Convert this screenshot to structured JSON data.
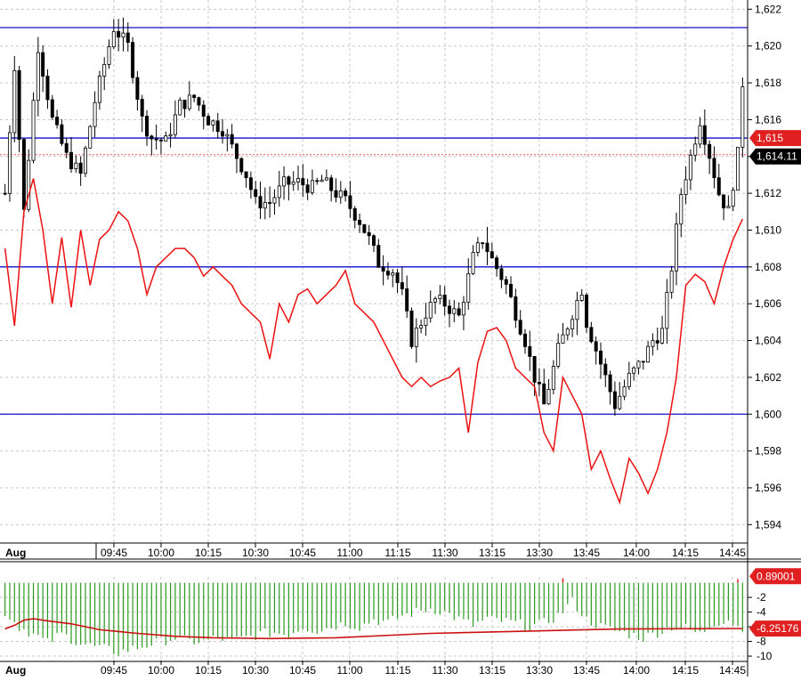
{
  "chart_data": [
    {
      "type": "candlestick",
      "panel": "price",
      "ylim": [
        1593,
        1622.5
      ],
      "yticks": [
        1594,
        1596,
        1598,
        1600,
        1602,
        1604,
        1606,
        1608,
        1610,
        1612,
        1614,
        1616,
        1618,
        1620,
        1622
      ],
      "ytick_labels": [
        "1,594",
        "1,596",
        "1,598",
        "1,600",
        "1,602",
        "1,604",
        "1,606",
        "1,608",
        "1,610",
        "1,612",
        "1,614",
        "1,616",
        "1,618",
        "1,620",
        "1,622"
      ],
      "date_label": "Aug",
      "xtick_labels": [
        "09:45",
        "10:00",
        "10:15",
        "10:30",
        "10:45",
        "11:00",
        "11:15",
        "11:30",
        "13:15",
        "13:30",
        "13:45",
        "14:00",
        "14:15",
        "14:45"
      ],
      "horizontal_levels": [
        1621,
        1615,
        1608,
        1600
      ],
      "last_price": 1614.1,
      "price_tags": [
        {
          "value": 1615,
          "label": "1,615",
          "color": "#e02020"
        },
        {
          "value": 1614.1,
          "label": "1,614.11",
          "color": "#000000"
        }
      ],
      "close_path": [
        [
          0,
          1612
        ],
        [
          2,
          1619
        ],
        [
          4,
          1611
        ],
        [
          7,
          1620
        ],
        [
          10,
          1616
        ],
        [
          13,
          1614
        ],
        [
          16,
          1613
        ],
        [
          19,
          1617
        ],
        [
          21,
          1619
        ],
        [
          23,
          1621
        ],
        [
          26,
          1620
        ],
        [
          29,
          1616
        ],
        [
          31,
          1615
        ],
        [
          34,
          1614.8
        ],
        [
          37,
          1616.8
        ],
        [
          40,
          1617.2
        ],
        [
          43,
          1616
        ],
        [
          46,
          1615.5
        ],
        [
          49,
          1614
        ],
        [
          51,
          1613
        ],
        [
          53,
          1611.5
        ],
        [
          56,
          1611.5
        ],
        [
          59,
          1612.5
        ],
        [
          62,
          1612.6
        ],
        [
          65,
          1612.3
        ],
        [
          67,
          1612.7
        ],
        [
          70,
          1612
        ],
        [
          72,
          1611.6
        ],
        [
          75,
          1610.5
        ],
        [
          77,
          1609.5
        ],
        [
          79,
          1608.2
        ],
        [
          82,
          1607.8
        ],
        [
          84,
          1606.5
        ],
        [
          86,
          1604
        ],
        [
          89,
          1605.5
        ],
        [
          91,
          1606.2
        ],
        [
          93,
          1606
        ],
        [
          96,
          1605.3
        ],
        [
          99,
          1608.5
        ],
        [
          101,
          1609.5
        ],
        [
          103,
          1608.4
        ],
        [
          106,
          1607
        ],
        [
          108,
          1605.5
        ],
        [
          110,
          1604
        ],
        [
          112,
          1602
        ],
        [
          114,
          1600.5
        ],
        [
          117,
          1603.5
        ],
        [
          120,
          1605.5
        ],
        [
          122,
          1606.8
        ],
        [
          123,
          1605
        ],
        [
          125,
          1603.5
        ],
        [
          127,
          1602
        ],
        [
          129,
          1600.5
        ],
        [
          132,
          1602
        ],
        [
          135,
          1603
        ],
        [
          137,
          1604
        ],
        [
          139,
          1604.5
        ],
        [
          141,
          1608
        ],
        [
          143,
          1612
        ],
        [
          145,
          1614
        ],
        [
          147,
          1616
        ],
        [
          149,
          1614.1
        ],
        [
          151,
          1612
        ],
        [
          153,
          1611
        ],
        [
          155,
          1614.1
        ],
        [
          156,
          1618
        ]
      ],
      "indicator_line": {
        "color": "#ee1111",
        "points": [
          [
            0,
            1609
          ],
          [
            2,
            1604.8
          ],
          [
            4,
            1611
          ],
          [
            6,
            1612.8
          ],
          [
            8,
            1610
          ],
          [
            10,
            1606
          ],
          [
            12,
            1609.6
          ],
          [
            14,
            1605.8
          ],
          [
            16,
            1610
          ],
          [
            18,
            1607
          ],
          [
            20,
            1609.5
          ],
          [
            22,
            1610
          ],
          [
            24,
            1611
          ],
          [
            26,
            1610.5
          ],
          [
            28,
            1609
          ],
          [
            30,
            1606.5
          ],
          [
            32,
            1608
          ],
          [
            34,
            1608.5
          ],
          [
            36,
            1609
          ],
          [
            38,
            1609
          ],
          [
            40,
            1608.5
          ],
          [
            42,
            1607.5
          ],
          [
            44,
            1608
          ],
          [
            46,
            1607.5
          ],
          [
            48,
            1607
          ],
          [
            50,
            1606
          ],
          [
            52,
            1605.5
          ],
          [
            54,
            1605
          ],
          [
            56,
            1603
          ],
          [
            58,
            1606
          ],
          [
            60,
            1605
          ],
          [
            62,
            1606.5
          ],
          [
            64,
            1606.8
          ],
          [
            66,
            1606
          ],
          [
            68,
            1606.5
          ],
          [
            70,
            1607
          ],
          [
            72,
            1607.8
          ],
          [
            74,
            1606
          ],
          [
            76,
            1605.5
          ],
          [
            78,
            1605
          ],
          [
            80,
            1604
          ],
          [
            82,
            1603
          ],
          [
            84,
            1602
          ],
          [
            86,
            1601.5
          ],
          [
            88,
            1602
          ],
          [
            90,
            1601.5
          ],
          [
            92,
            1601.8
          ],
          [
            94,
            1602
          ],
          [
            96,
            1602.5
          ],
          [
            98,
            1599
          ],
          [
            100,
            1602.8
          ],
          [
            102,
            1604.5
          ],
          [
            104,
            1604.7
          ],
          [
            106,
            1604
          ],
          [
            108,
            1602.5
          ],
          [
            110,
            1602
          ],
          [
            112,
            1601.5
          ],
          [
            114,
            1599
          ],
          [
            116,
            1598
          ],
          [
            118,
            1602
          ],
          [
            120,
            1601
          ],
          [
            122,
            1600
          ],
          [
            124,
            1597
          ],
          [
            126,
            1598
          ],
          [
            128,
            1596.5
          ],
          [
            130,
            1595.2
          ],
          [
            132,
            1597.6
          ],
          [
            134,
            1596.8
          ],
          [
            136,
            1595.7
          ],
          [
            138,
            1597
          ],
          [
            140,
            1599
          ],
          [
            142,
            1602
          ],
          [
            144,
            1607
          ],
          [
            146,
            1607.6
          ],
          [
            148,
            1607.2
          ],
          [
            150,
            1606
          ],
          [
            152,
            1608
          ],
          [
            154,
            1609.5
          ],
          [
            156,
            1610.6
          ]
        ]
      }
    },
    {
      "type": "bar",
      "panel": "histogram",
      "ylim": [
        -10.6,
        0.8
      ],
      "yticks": [
        -2,
        -4,
        -6,
        -8,
        -10
      ],
      "ytick_labels": [
        "-2",
        "-4",
        "-6",
        "-8",
        "-10"
      ],
      "date_label": "Aug",
      "xtick_labels": [
        "09:45",
        "10:00",
        "10:15",
        "10:30",
        "10:45",
        "11:00",
        "11:15",
        "11:30",
        "13:15",
        "13:30",
        "13:45",
        "14:00",
        "14:15",
        "14:45"
      ],
      "bar_color": "#2a9a1e",
      "positive_bar_color": "#e02020",
      "values_path": [
        [
          0,
          -4
        ],
        [
          3,
          -6
        ],
        [
          6,
          -7
        ],
        [
          9,
          -8.2
        ],
        [
          12,
          -7
        ],
        [
          15,
          -8
        ],
        [
          18,
          -8.6
        ],
        [
          21,
          -9
        ],
        [
          24,
          -9.5
        ],
        [
          27,
          -9
        ],
        [
          30,
          -8.5
        ],
        [
          33,
          -8
        ],
        [
          36,
          -7.5
        ],
        [
          39,
          -8
        ],
        [
          42,
          -8
        ],
        [
          45,
          -7.5
        ],
        [
          48,
          -8
        ],
        [
          51,
          -7.5
        ],
        [
          54,
          -7
        ],
        [
          57,
          -6.8
        ],
        [
          60,
          -7
        ],
        [
          63,
          -6
        ],
        [
          66,
          -6.5
        ],
        [
          69,
          -6
        ],
        [
          72,
          -5.5
        ],
        [
          75,
          -6
        ],
        [
          78,
          -5
        ],
        [
          81,
          -5.5
        ],
        [
          84,
          -4.5
        ],
        [
          87,
          -4
        ],
        [
          90,
          -3.5
        ],
        [
          93,
          -4
        ],
        [
          96,
          -5
        ],
        [
          99,
          -5.8
        ],
        [
          102,
          -5
        ],
        [
          105,
          -5.2
        ],
        [
          108,
          -5.5
        ],
        [
          111,
          -6
        ],
        [
          114,
          -5.5
        ],
        [
          117,
          -4.5
        ],
        [
          120,
          -2.5
        ],
        [
          123,
          -5
        ],
        [
          126,
          -6
        ],
        [
          129,
          -6.5
        ],
        [
          132,
          -7
        ],
        [
          135,
          -7.5
        ],
        [
          138,
          -6.8
        ],
        [
          141,
          -6
        ],
        [
          144,
          -6.2
        ],
        [
          147,
          -7
        ],
        [
          150,
          -5.5
        ],
        [
          153,
          -5
        ],
        [
          155,
          -6
        ]
      ],
      "positive_spikes": [
        [
          118,
          0.6
        ],
        [
          155,
          0.5
        ]
      ],
      "signal_line": {
        "color": "#cc1111",
        "points": [
          [
            0,
            -6.3
          ],
          [
            2,
            -5.8
          ],
          [
            4,
            -5.1
          ],
          [
            6,
            -4.9
          ],
          [
            9,
            -5.2
          ],
          [
            14,
            -5.6
          ],
          [
            20,
            -6.4
          ],
          [
            28,
            -6.9
          ],
          [
            36,
            -7.3
          ],
          [
            44,
            -7.5
          ],
          [
            56,
            -7.6
          ],
          [
            70,
            -7.5
          ],
          [
            90,
            -6.9
          ],
          [
            110,
            -6.6
          ],
          [
            130,
            -6.3
          ],
          [
            156,
            -6.25
          ]
        ]
      },
      "value_tags": [
        {
          "value": 0.89,
          "label": "0.89001",
          "color": "#e02020"
        },
        {
          "value": -6.2517,
          "label": "-6.25176",
          "color": "#e02020"
        }
      ]
    }
  ]
}
